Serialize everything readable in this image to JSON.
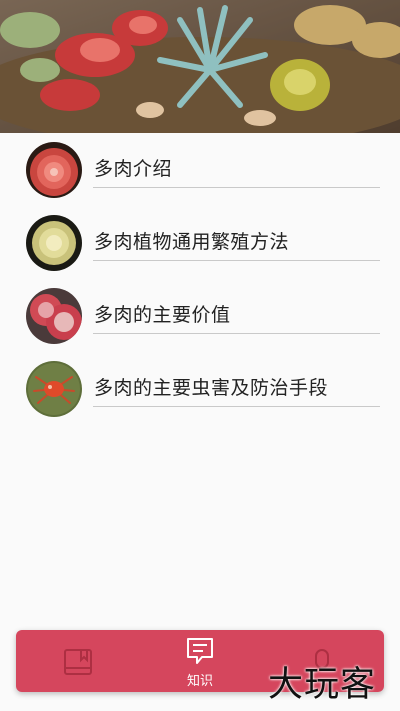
{
  "banner": {
    "image_name": "succulent-wreath-photo"
  },
  "knowledge_list": [
    {
      "label": "多肉介绍",
      "thumb": "red-succulent-thumb"
    },
    {
      "label": "多肉植物通用繁殖方法",
      "thumb": "yellow-green-succulent-thumb"
    },
    {
      "label": "多肉的主要价值",
      "thumb": "pink-succulent-thumb"
    },
    {
      "label": "多肉的主要虫害及防治手段",
      "thumb": "red-spider-mite-thumb"
    }
  ],
  "tabbar": {
    "tabs": [
      {
        "icon": "book-icon",
        "label": "",
        "active": false
      },
      {
        "icon": "message-list-icon",
        "label": "知识",
        "active": true
      },
      {
        "icon": "person-icon",
        "label": "",
        "active": false
      }
    ],
    "accent_color": "#d5465d"
  },
  "watermark": {
    "text": "大玩客"
  }
}
